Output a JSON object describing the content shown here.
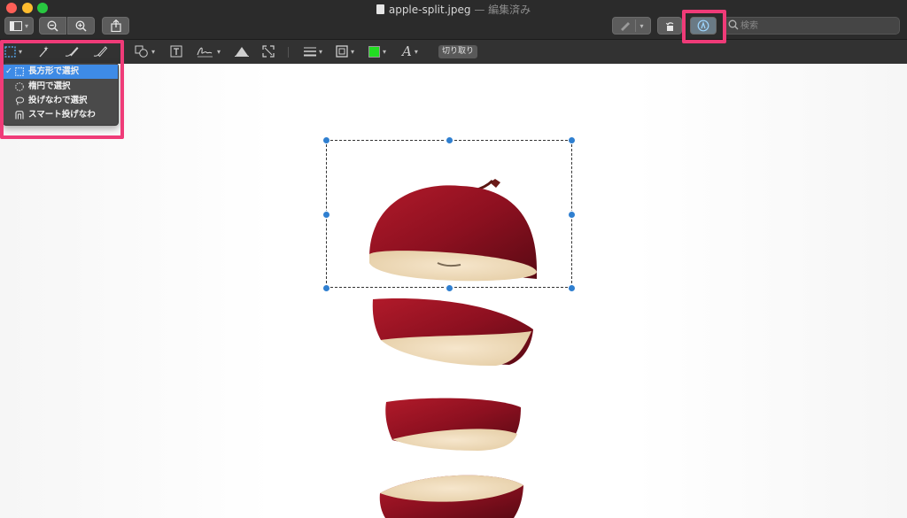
{
  "window": {
    "title": "apple-split.jpeg",
    "edited_suffix": "— 編集済み",
    "traffic_lights": [
      "#fe5f57",
      "#febc2e",
      "#28c840"
    ]
  },
  "toolbar": {
    "items": [
      "sidebar-toggle",
      "zoom-out",
      "zoom-in",
      "share",
      "markup-pen",
      "rotate",
      "markup-toolbar-toggle"
    ]
  },
  "search": {
    "placeholder": "検索"
  },
  "markup": {
    "tools": [
      "selection",
      "instant-alpha",
      "sketch",
      "draw",
      "shapes",
      "text",
      "sign",
      "adjust-color",
      "adjust-size",
      "line-style",
      "border-color",
      "fill-color",
      "text-style"
    ],
    "fill_color": "#22dd22",
    "crop_label": "切り取り"
  },
  "selection_menu": {
    "items": [
      {
        "label": "長方形で選択",
        "selected": true,
        "check": "✓"
      },
      {
        "label": "楕円で選択",
        "selected": false
      },
      {
        "label": "投げなわで選択",
        "selected": false
      },
      {
        "label": "スマート投げなわ",
        "selected": false
      }
    ]
  },
  "colors": {
    "highlight": "#ef3b78",
    "selection_handle": "#2f7fd0",
    "menu_selected": "#3e8be6"
  }
}
